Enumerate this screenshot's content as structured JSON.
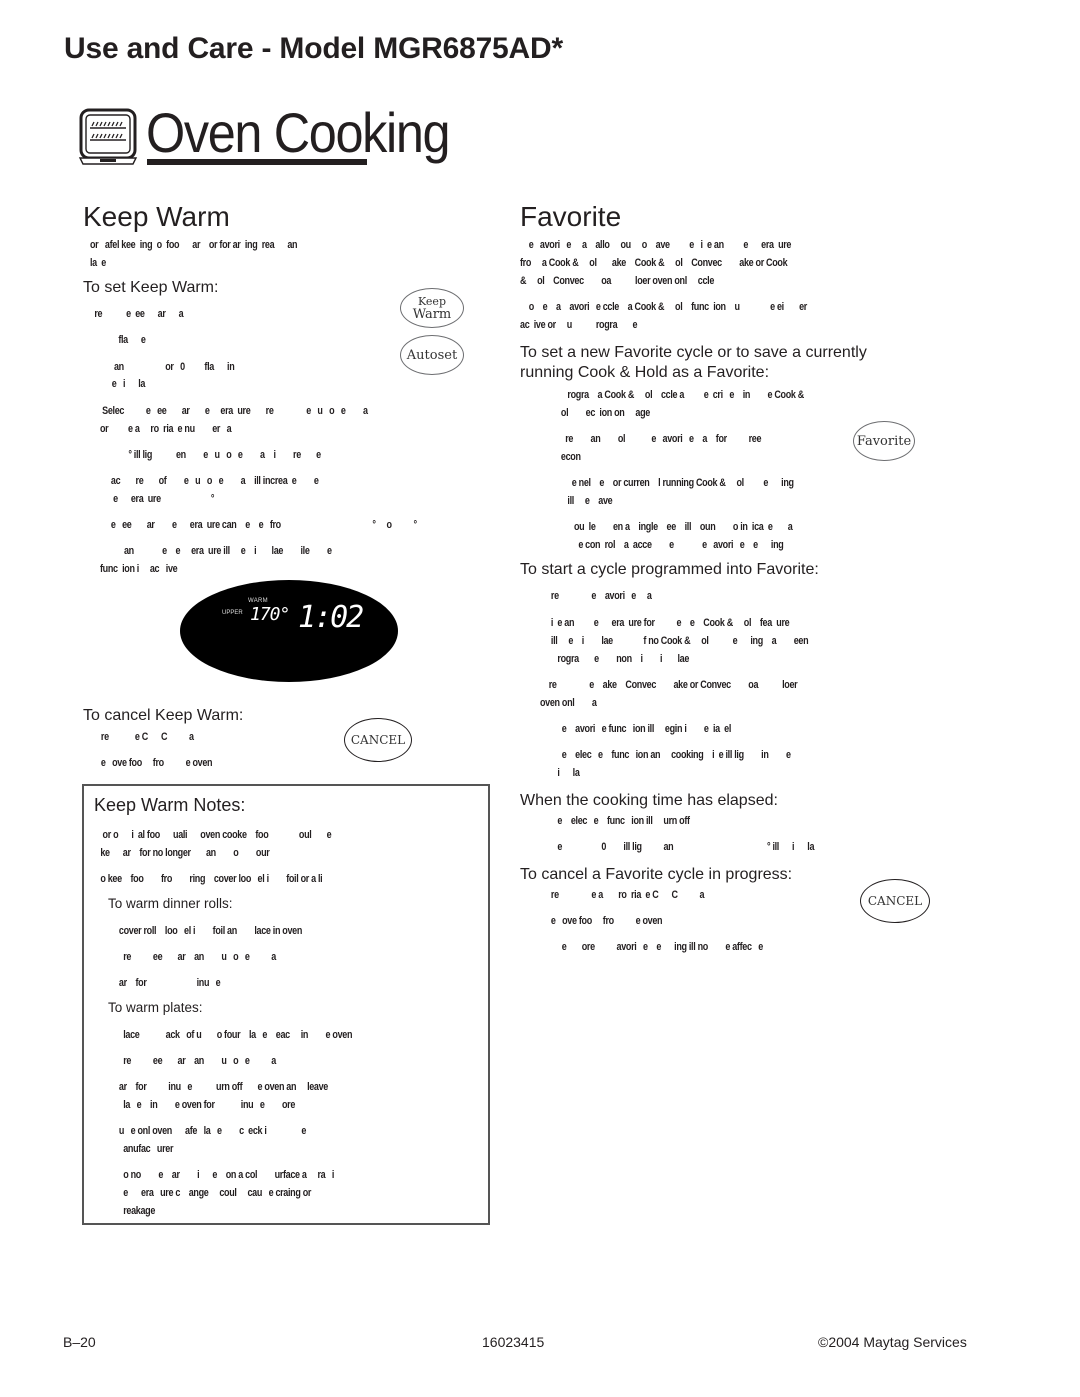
{
  "header": {
    "model_title": "Use and Care - Model MGR6875AD*",
    "section_title": "Oven Cooking",
    "section_icon": "oven-icon"
  },
  "keep_warm": {
    "title": "Keep Warm",
    "intro": [
      "or   afel kee  ing  o  foo      ar    or for ar  ing  rea      an",
      "la  e"
    ],
    "set_heading": "To set Keep Warm:",
    "set_steps": [
      [
        "  re           e  ee      ar      a"
      ],
      [
        "             fla      e"
      ],
      [
        "           an                   or   0         fla      in",
        "          e   i      la"
      ],
      [
        " Selec          e   ee       ar       e     era  ure       re               e   u   o   e        a",
        "or         e a     ro  ria  e nu        er   a"
      ],
      [
        "             ° ill lig           en        e   u   o   e        a    i        re       e"
      ],
      [
        "     ac       re       of        e   u   o   e        a    ill increa  e        e",
        "      e      era  ure                       °"
      ],
      [
        "     e   ee       ar        e      era  ure can    e    e   fro                                          °     o          °"
      ],
      [
        "           an             e    e     era  ure ill     e    i       lae        ile        e",
        "func  ion i     ac   ive"
      ]
    ],
    "buttons": {
      "keep_warm_line1": "Keep",
      "keep_warm_line2": "Warm",
      "autoset": "Autoset"
    },
    "display": {
      "mode_label": "WARM",
      "oven_label": "UPPER",
      "temperature": "170°",
      "time": "1:02"
    },
    "cancel_heading": "To cancel Keep Warm:",
    "cancel_steps": [
      "     re            e C      C          a",
      "     e   ove foo     fro          e oven"
    ],
    "cancel_button": "CANCEL"
  },
  "keep_warm_notes": {
    "title": "Keep Warm Notes:",
    "notes": [
      [
        "   or o      i  al foo      uali      oven cooke    foo              oul       e",
        "  ke      ar    for no longer       an        o        our"
      ],
      [
        "  o kee    foo        fro        ring    cover loo   el i        foil or a li"
      ]
    ],
    "dinner_rolls_heading": "To warm dinner rolls:",
    "dinner_rolls_steps": [
      "     cover roll    loo   el i        foil an        lace in oven",
      "       re          ee       ar    an        u   o   e          a",
      "     ar    for                       inu   e"
    ],
    "plates_heading": "To warm plates:",
    "plates_steps": [
      [
        "       lace            ack   of u       o four    la   e    eac     in        e oven"
      ],
      [
        "       re          ee       ar    an        u   o   e          a"
      ],
      [
        "     ar    for          inu   e           urn off       e oven an     leave",
        "       la   e    in        e oven for            inu   e        ore"
      ],
      [
        "     u   e onl oven      afe   la   e        c  eck i                e",
        "       anufac   urer"
      ],
      [
        "       o no        e    ar        i      e    on a col        urface a     ra   i",
        "       e      era   ure c    ange     coul     cau   e craing or",
        "       reakage"
      ]
    ]
  },
  "favorite": {
    "title": "Favorite",
    "intro": [
      [
        "    e   avori   e     a    allo     ou     o    ave         e   i  e an         e      era  ure",
        "fro     a Cook &     ol       ake    Cook &     ol    Convec        ake or Cook",
        "&     ol    Convec        oa           loer oven onl     ccle"
      ],
      [
        "    o    e    a    avori   e ccle    a Cook &     ol    func  ion    u              e ei       er",
        "ac  ive or     u           rogra       e"
      ]
    ],
    "set_heading": "To set a new Favorite cycle or to save a currently running Cook & Hold as a Favorite:",
    "set_steps": [
      [
        "        rogra    a Cook &     ol    ccle a         e  cri   e    in        e Cook &",
        "     ol        ec  ion on     age"
      ],
      [
        "       re        an        ol            e   avori   e    a    for          ree",
        "     econ"
      ],
      [
        "          e nel    e    or curren    l running Cook &     ol         e      ing",
        "        ill     e    ave"
      ],
      [
        "           ou  le        en a    ingle    ee    ill    oun        o in  ica  e       a",
        "             e con  rol    a  acce        e             e   avori   e    e      ing"
      ]
    ],
    "favorite_button": "Favorite",
    "start_heading": "To start a cycle programmed into Favorite:",
    "start_steps": [
      [
        "     re               e    avori   e     a"
      ],
      [
        "     i  e an         e      era  ure for          e    e    Cook &     ol    fea  ure",
        "     ill     e    i        lae              f no Cook &     ol           e      ing    a        een",
        "        rogra       e        non    i        i       lae"
      ],
      [
        "    re               e    ake    Convec        ake or Convec        oa           loer",
        "oven onl        a"
      ],
      [
        "          e    avori   e func   ion ill     egin i        e  ia  el"
      ],
      [
        "          e    elec   e    func   ion an     cooking    i  e ill lig        in        e",
        "        i      la"
      ]
    ],
    "elapsed_heading": "When the cooking time has elapsed:",
    "elapsed_steps": [
      "        e    elec   e    func   ion ill     urn off",
      "        e                  0        ill lig          an                                           ° ill      i      la"
    ],
    "cancel_heading": "To cancel a Favorite cycle in progress:",
    "cancel_steps": [
      "     re               e a       ro  ria  e C      C          a",
      "     e   ove foo     fro          e oven",
      "          e       ore          avori   e    e      ing ill no        e affec   e"
    ],
    "cancel_button": "CANCEL"
  },
  "footer": {
    "page_number": "B–20",
    "document_number": "16023415",
    "copyright": "©2004 Maytag Services"
  }
}
